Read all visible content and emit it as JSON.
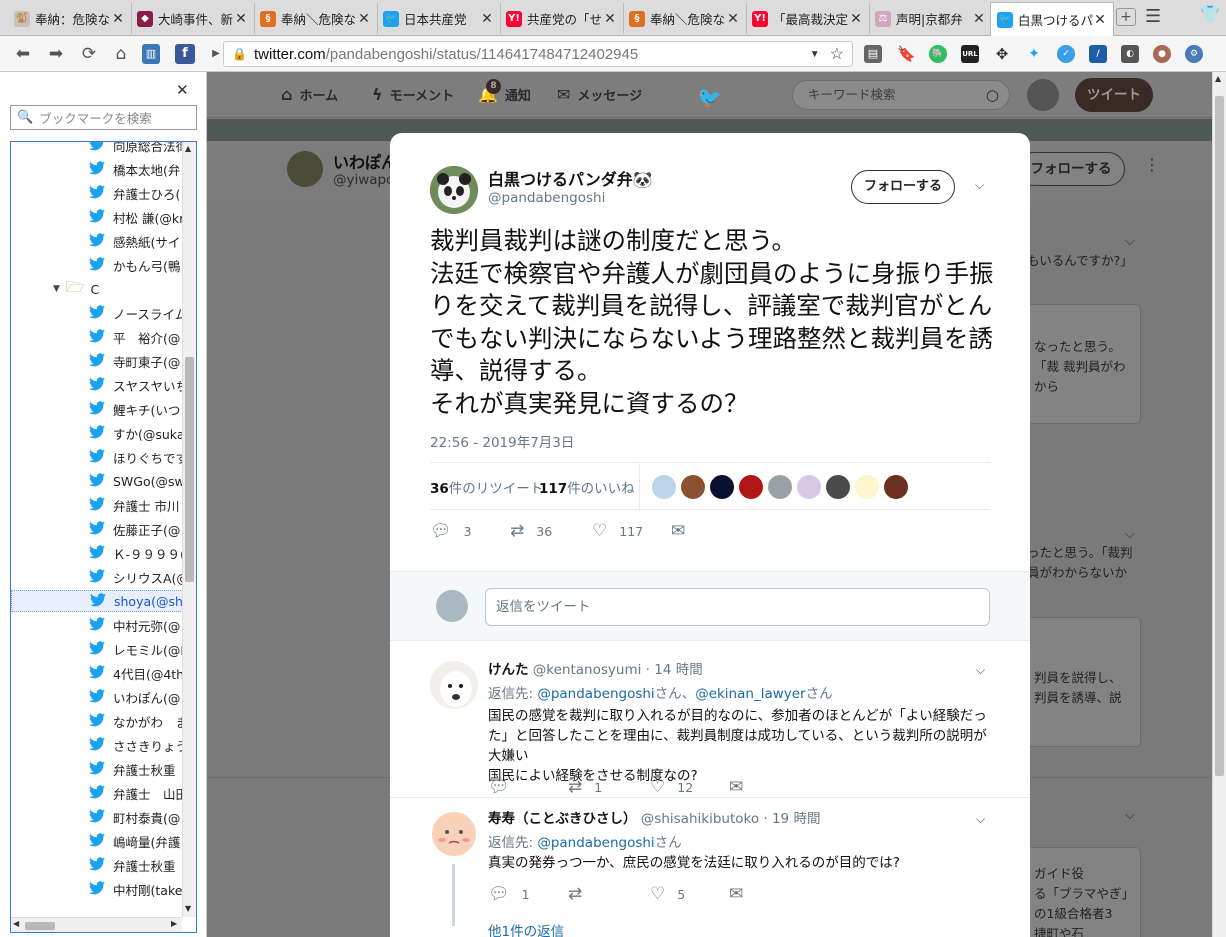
{
  "browser": {
    "tabs": [
      {
        "title": "奉納：危険な",
        "fav_color": "#c9c2b4",
        "fav_glyph": "🐒"
      },
      {
        "title": "大崎事件、新",
        "fav_color": "#8a1a4a",
        "fav_glyph": "◆"
      },
      {
        "title": "奉納＼危険な",
        "fav_color": "#e07020",
        "fav_glyph": "§"
      },
      {
        "title": "日本共産党",
        "fav_color": "#1da1f2",
        "fav_glyph": "🐦"
      },
      {
        "title": "共産党の「せ",
        "fav_color": "#ff0033",
        "fav_glyph": "Y!"
      },
      {
        "title": "奉納＼危険な",
        "fav_color": "#e07020",
        "fav_glyph": "§"
      },
      {
        "title": "「最高裁決定",
        "fav_color": "#ff0033",
        "fav_glyph": "Y!"
      },
      {
        "title": "声明|京都弁",
        "fav_color": "#d3a5c0",
        "fav_glyph": "⚖"
      },
      {
        "title": "白黒つけるパ",
        "fav_color": "#1da1f2",
        "fav_glyph": "🐦"
      }
    ],
    "url_host": "twitter.com",
    "url_path": "/pandabengoshi/status/1146417484712402945",
    "ext_url_label": "URL"
  },
  "sidebar": {
    "search_placeholder": "ブックマークを検索",
    "folder_label": "C",
    "items_before": [
      "向原総合法律",
      "橋本太地(弁",
      "弁護士ひろ(",
      "村松 謙(@kr",
      "感熱紙(サイ",
      "かもん弓(鴨"
    ],
    "items_after": [
      "ノースライム(",
      "平　裕介(@",
      "寺町東子(@",
      "スヤスヤいち",
      "鯉キチ(いつ",
      "すか(@suka",
      "ほりぐちです",
      "SWGo(@sw",
      "弁護士 市川",
      "佐藤正子(@",
      "Ｋ-９９９９(@",
      "シリウスA(@",
      "shoya(@sh",
      "中村元弥(@",
      "レモミル(@L",
      "4代目(@4th",
      "いわぽん(@",
      "なかがわ　ま",
      "ささきりょう(",
      "弁護士秋重",
      "弁護士　山田",
      "町村泰貴(@",
      "嶋﨑量(弁護",
      "弁護士秋重",
      "中村剛(take"
    ],
    "selected_index": 12
  },
  "twitter_header": {
    "home": "ホーム",
    "moments": "モーメント",
    "notifications": "通知",
    "notifications_badge": "8",
    "messages": "メッセージ",
    "search_placeholder": "キーワード検索",
    "tweet_button": "ツイート"
  },
  "profile": {
    "name": "いわぽん",
    "handle": "@yiwapo",
    "follow_label": "フォローする"
  },
  "background_cards": [
    "もいるんですか?」",
    "なったと思う。「裁\n裁判員がわから",
    "ったと思う。「裁判\n員がわからないか",
    "判員を説得し、\n判員を誘導、説",
    "ガイド役\nる「ブラマやぎ」\nの1級合格者3\n捷町や石"
  ],
  "tweet": {
    "name": "白黒つけるパンダ弁🐼",
    "handle": "@pandabengoshi",
    "follow_label": "フォローする",
    "text": "裁判員裁判は謎の制度だと思う。\n法廷で検察官や弁護人が劇団員のように身振り手振りを交えて裁判員を説得し、評議室で裁判官がとんでもない判決にならないよう理路整然と裁判員を誘導、説得する。\nそれが真実発見に資するの？",
    "timestamp": "22:56 - 2019年7月3日",
    "retweets_count": "36",
    "retweets_label": "件のリツイート",
    "likes_count": "117",
    "likes_label": "件のいいね",
    "reply_count": "3",
    "retweet_count": "36",
    "like_count": "117",
    "liker_avatar_colors": [
      "#bcd4ea",
      "#8a5030",
      "#0a1030",
      "#b01818",
      "#9aa0a6",
      "#d8c8e8",
      "#4a4a4a",
      "#fff6d0",
      "#6a3020"
    ]
  },
  "reply_box": {
    "placeholder": "返信をツイート"
  },
  "replies": [
    {
      "name": "けんた",
      "handle": "@kentanosyumi",
      "time": "· 14 時間",
      "reply_to_prefix": "返信先: ",
      "reply_to": "@pandabengoshi",
      "reply_to_sep": "さん、",
      "reply_to_2": "@ekinan_lawyer",
      "reply_to_suffix": "さん",
      "text": "国民の感覚を裁判に取り入れるが目的なのに、参加者のほとんどが「よい経験だった」と回答したことを理由に、裁判員制度は成功している、という裁判所の説明が大嫌い\n国民によい経験をさせる制度なの?",
      "reply_count": "",
      "retweet_count": "1",
      "like_count": "12"
    },
    {
      "name": "寿寿（ことぶきひさし）",
      "handle": "@shisahikibutoko",
      "time": "· 19 時間",
      "reply_to_prefix": "返信先: ",
      "reply_to": "@pandabengoshi",
      "reply_to_suffix": "さん",
      "text": "真実の発券っつ一か、庶民の感覚を法廷に取り入れるのが目的では?",
      "reply_count": "1",
      "retweet_count": "",
      "like_count": "5",
      "more_replies": "他1件の返信"
    }
  ]
}
